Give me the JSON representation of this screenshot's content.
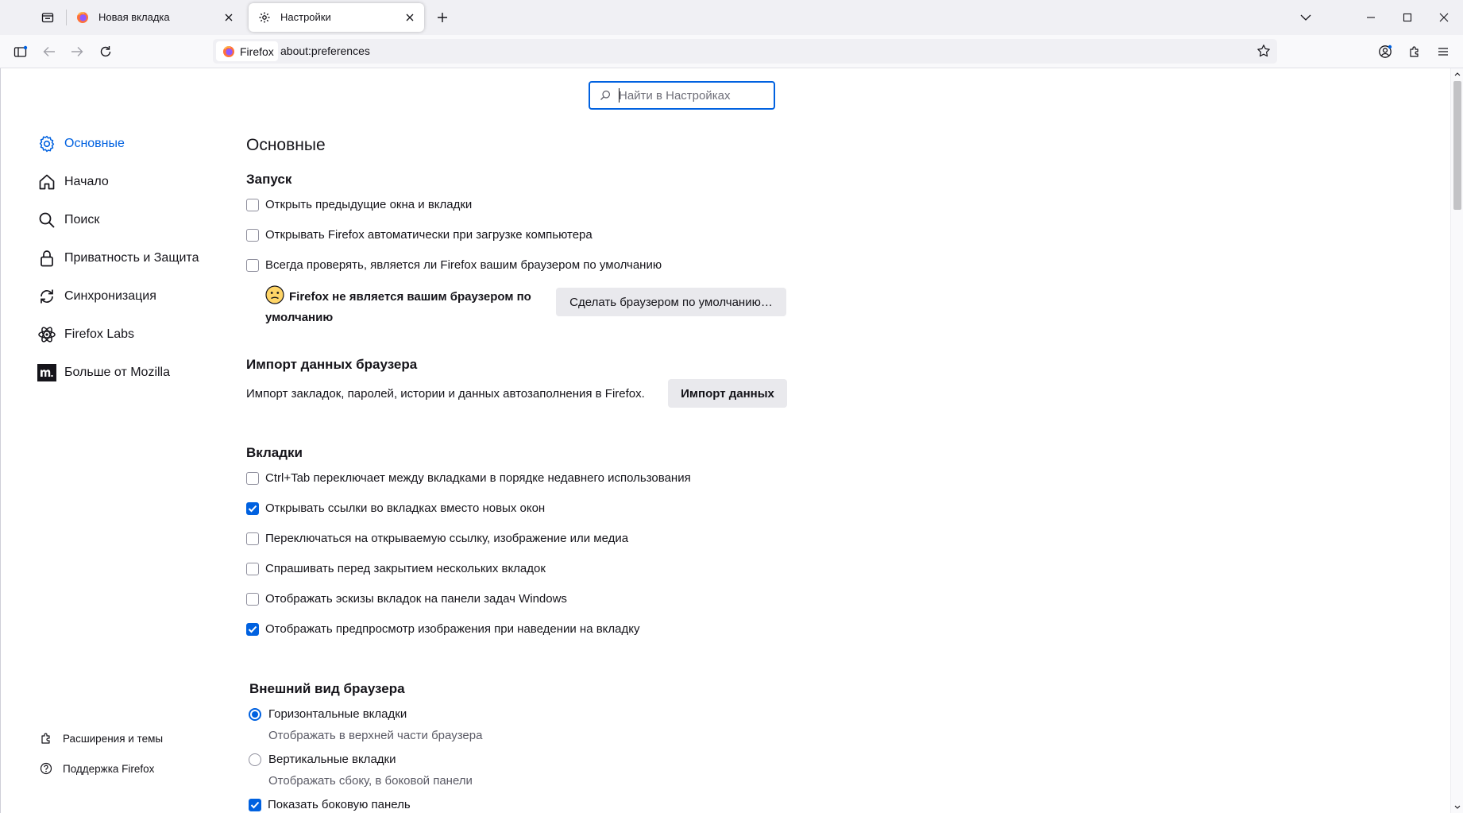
{
  "tabs": [
    {
      "title": "Новая вкладка"
    },
    {
      "title": "Настройки"
    }
  ],
  "toolbar": {
    "identity_label": "Firefox",
    "url": "about:preferences"
  },
  "search": {
    "placeholder": "Найти в Настройках"
  },
  "sidebar": {
    "items": [
      {
        "label": "Основные",
        "icon": "gear-icon",
        "selected": true
      },
      {
        "label": "Начало",
        "icon": "home-icon"
      },
      {
        "label": "Поиск",
        "icon": "search-icon"
      },
      {
        "label": "Приватность и Защита",
        "icon": "lock-icon"
      },
      {
        "label": "Синхронизация",
        "icon": "sync-icon"
      },
      {
        "label": "Firefox Labs",
        "icon": "labs-atom-icon"
      },
      {
        "label": "Больше от Mozilla",
        "icon": "mozilla-m-icon"
      }
    ],
    "footer": [
      {
        "label": "Расширения и темы",
        "icon": "puzzle-icon"
      },
      {
        "label": "Поддержка Firefox",
        "icon": "help-icon"
      }
    ]
  },
  "main": {
    "page_title": "Основные",
    "startup": {
      "heading": "Запуск",
      "options": [
        {
          "label": "Открыть предыдущие окна и вкладки",
          "checked": false
        },
        {
          "label": "Открывать Firefox автоматически при загрузке компьютера",
          "checked": false
        },
        {
          "label": "Всегда проверять, является ли Firefox вашим браузером по умолчанию",
          "checked": false
        }
      ],
      "default_status_line1": "Firefox не является вашим браузером по",
      "default_status_line2": "умолчанию",
      "make_default_button": "Сделать браузером по умолчанию…"
    },
    "import": {
      "heading": "Импорт данных браузера",
      "description": "Импорт закладок, паролей, истории и данных автозаполнения в Firefox.",
      "button": "Импорт данных"
    },
    "tabs_section": {
      "heading": "Вкладки",
      "options": [
        {
          "label": "Ctrl+Tab переключает между вкладками в порядке недавнего использования",
          "checked": false
        },
        {
          "label": "Открывать ссылки во вкладках вместо новых окон",
          "checked": true
        },
        {
          "label": "Переключаться на открываемую ссылку, изображение или медиа",
          "checked": false
        },
        {
          "label": "Спрашивать перед закрытием нескольких вкладок",
          "checked": false
        },
        {
          "label": "Отображать эскизы вкладок на панели задач Windows",
          "checked": false
        },
        {
          "label": "Отображать предпросмотр изображения при наведении на вкладку",
          "checked": true
        }
      ]
    },
    "appearance": {
      "heading": "Внешний вид браузера",
      "radios": [
        {
          "label": "Горизонтальные вкладки",
          "description": "Отображать в верхней части браузера",
          "checked": true
        },
        {
          "label": "Вертикальные вкладки",
          "description": "Отображать сбоку, в боковой панели",
          "checked": false
        }
      ],
      "sidebar_option": {
        "label": "Показать боковую панель",
        "checked": true
      }
    }
  },
  "colors": {
    "accent": "#0061e0",
    "tabstrip_bg": "#f0f0f4",
    "button_bg": "#e9e9ed"
  }
}
